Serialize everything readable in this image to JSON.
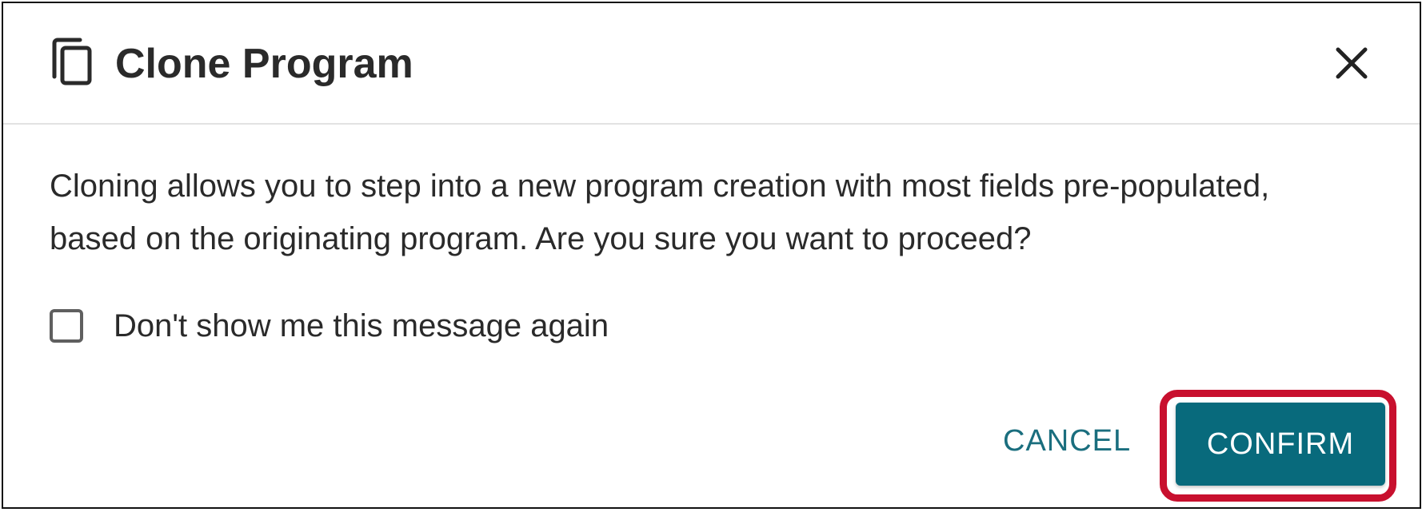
{
  "dialog": {
    "title": "Clone Program",
    "title_icon": "clone-icon",
    "close_icon": "close-icon",
    "message": "Cloning allows you to step into a new program creation with most fields pre-populated, based on the originating program. Are you sure you want to proceed?",
    "checkbox": {
      "label": "Don't show me this message again",
      "checked": false
    },
    "buttons": {
      "cancel_label": "CANCEL",
      "confirm_label": "CONFIRM"
    }
  },
  "colors": {
    "accent": "#086a7c",
    "cancel_text": "#1a6e7e",
    "highlight": "#c8102e"
  }
}
